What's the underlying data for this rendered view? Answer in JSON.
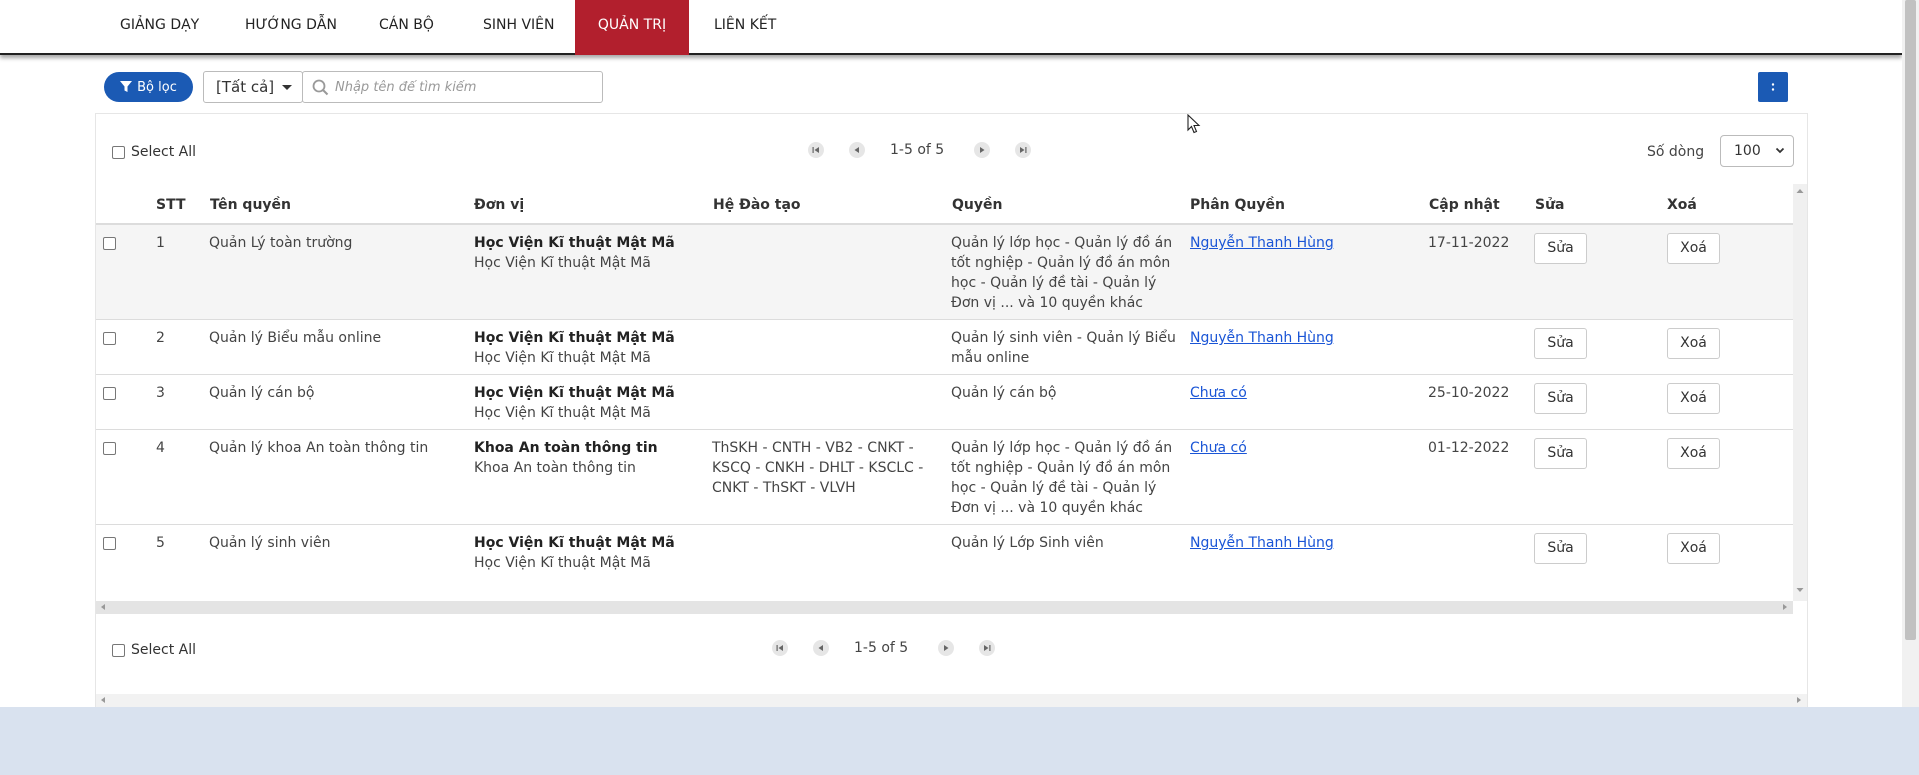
{
  "nav": {
    "items": [
      {
        "label": "GIẢNG DẠY"
      },
      {
        "label": "HƯỚNG DẪN"
      },
      {
        "label": "CÁN BỘ"
      },
      {
        "label": "SINH VIÊN"
      },
      {
        "label": "QUẢN TRỊ",
        "active": true
      },
      {
        "label": "LIÊN KẾT"
      }
    ]
  },
  "toolbar": {
    "filter_label": "Bộ lọc",
    "type_select_value": "[Tất cả]",
    "search_placeholder": "Nhập tên để tìm kiếm",
    "search_value": ""
  },
  "list": {
    "select_all_label": "Select All",
    "pagination_text": "1-5 of 5",
    "rows_label": "Số dòng",
    "rows_value": "100"
  },
  "table": {
    "headers": [
      "STT",
      "Tên quyền",
      "Đơn vị",
      "Hệ Đào tạo",
      "Quyền",
      "Phân Quyền",
      "Cập nhật",
      "Sửa",
      "Xoá"
    ],
    "edit_label": "Sửa",
    "delete_label": "Xoá",
    "rows": [
      {
        "stt": "1",
        "name": "Quản Lý toàn trường",
        "unit_bold": "Học Viện Kĩ thuật Mật Mã",
        "unit": "Học Viện Kĩ thuật Mật Mã",
        "training": "",
        "rights": "Quản lý lớp học - Quản lý đồ án tốt nghiệp - Quản lý đồ án môn học - Quản lý đề tài - Quản lý Đơn vị ... và 10 quyền khác",
        "assign": "Nguyễn Thanh Hùng",
        "updated": "17-11-2022"
      },
      {
        "stt": "2",
        "name": "Quản lý Biểu mẫu online",
        "unit_bold": "Học Viện Kĩ thuật Mật Mã",
        "unit": "Học Viện Kĩ thuật Mật Mã",
        "training": "",
        "rights": "Quản lý sinh viên - Quản lý Biểu mẫu online",
        "assign": "Nguyễn Thanh Hùng",
        "updated": ""
      },
      {
        "stt": "3",
        "name": "Quản lý cán bộ",
        "unit_bold": "Học Viện Kĩ thuật Mật Mã",
        "unit": "Học Viện Kĩ thuật Mật Mã",
        "training": "",
        "rights": "Quản lý cán bộ",
        "assign": "Chưa có",
        "updated": "25-10-2022"
      },
      {
        "stt": "4",
        "name": "Quản lý khoa An toàn thông tin",
        "unit_bold": "Khoa An toàn thông tin",
        "unit": "Khoa An toàn thông tin",
        "training": "ThSKH - CNTH - VB2 - CNKT - KSCQ - CNKH - DHLT - KSCLC - CNKT - ThSKT - VLVH",
        "rights": "Quản lý lớp học - Quản lý đồ án tốt nghiệp - Quản lý đồ án môn học - Quản lý đề tài - Quản lý Đơn vị ... và 10 quyền khác",
        "assign": "Chưa có",
        "updated": "01-12-2022"
      },
      {
        "stt": "5",
        "name": "Quản lý sinh viên",
        "unit_bold": "Học Viện Kĩ thuật Mật Mã",
        "unit": "Học Viện Kĩ thuật Mật Mã",
        "training": "",
        "rights": "Quản lý Lớp Sinh viên",
        "assign": "Nguyễn Thanh Hùng",
        "updated": ""
      }
    ]
  },
  "colors": {
    "nav_active": "#b21f2d",
    "primary": "#1b5ab4",
    "link": "#1a55d6",
    "footer": "#d9e2ef"
  }
}
